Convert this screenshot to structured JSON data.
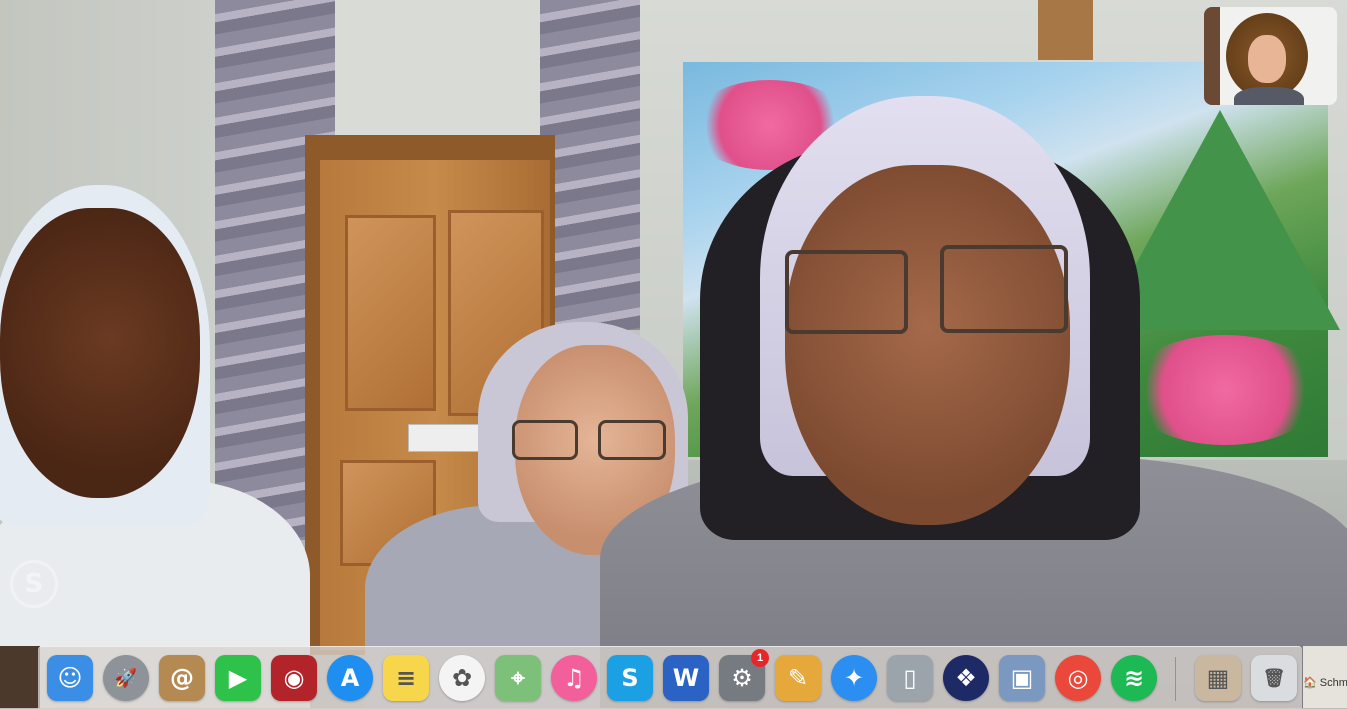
{
  "call": {
    "watermark_glyph": "S",
    "self_view_label": ""
  },
  "finder_window": {
    "title_fragment": "Schme"
  },
  "dock": {
    "badges": {
      "system_preferences": "1"
    },
    "items": [
      {
        "name": "Finder",
        "icon": "finder-icon",
        "glyph": "☺",
        "color": "#3a8ee6"
      },
      {
        "name": "Launchpad",
        "icon": "rocket-icon",
        "glyph": "🚀",
        "color": "#8d9399"
      },
      {
        "name": "Contacts",
        "icon": "contacts-icon",
        "glyph": "@",
        "color": "#b58a52"
      },
      {
        "name": "FaceTime",
        "icon": "video-camera-icon",
        "glyph": "▶",
        "color": "#2fc24a"
      },
      {
        "name": "Photo Booth",
        "icon": "photo-booth-icon",
        "glyph": "◉",
        "color": "#b3242a"
      },
      {
        "name": "App Store",
        "icon": "app-store-icon",
        "glyph": "A",
        "color": "#1e8ef0"
      },
      {
        "name": "Notes",
        "icon": "notes-icon",
        "glyph": "≡",
        "color": "#f7d64c"
      },
      {
        "name": "Photos",
        "icon": "photos-icon",
        "glyph": "✿",
        "color": "#f4f4f4"
      },
      {
        "name": "Maps",
        "icon": "maps-icon",
        "glyph": "⌖",
        "color": "#7dc07a"
      },
      {
        "name": "iTunes",
        "icon": "music-note-icon",
        "glyph": "♫",
        "color": "#f35f9a"
      },
      {
        "name": "Skype",
        "icon": "skype-icon",
        "glyph": "S",
        "color": "#1ca0e4"
      },
      {
        "name": "Word",
        "icon": "word-icon",
        "glyph": "W",
        "color": "#2b63c4"
      },
      {
        "name": "System Preferences",
        "icon": "gear-icon",
        "glyph": "⚙",
        "color": "#767b82"
      },
      {
        "name": "Paintbrush",
        "icon": "paint-bucket-icon",
        "glyph": "✎",
        "color": "#e6a83a"
      },
      {
        "name": "Safari",
        "icon": "compass-icon",
        "glyph": "✦",
        "color": "#2d8ef2"
      },
      {
        "name": "iPhone Backup",
        "icon": "phone-icon",
        "glyph": "▯",
        "color": "#9ba3ab"
      },
      {
        "name": "Dropbox",
        "icon": "dropbox-icon",
        "glyph": "❖",
        "color": "#1e2a66"
      },
      {
        "name": "Preview",
        "icon": "preview-icon",
        "glyph": "▣",
        "color": "#7a98c0"
      },
      {
        "name": "Chrome",
        "icon": "chrome-icon",
        "glyph": "◎",
        "color": "#e9483a"
      },
      {
        "name": "Spotify",
        "icon": "spotify-icon",
        "glyph": "≋",
        "color": "#1db954"
      },
      {
        "name": "Downloads Stack",
        "icon": "image-stack-icon",
        "glyph": "▦",
        "color": "#c9b7a0"
      },
      {
        "name": "Trash",
        "icon": "trash-icon",
        "glyph": "🗑",
        "color": "#dadde0"
      }
    ]
  }
}
